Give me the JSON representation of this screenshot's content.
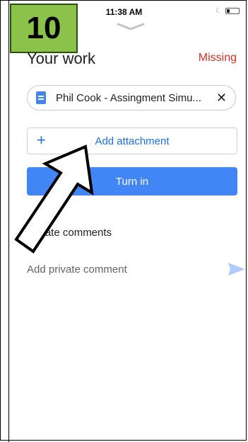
{
  "status_bar": {
    "time": "11:38 AM"
  },
  "step_badge": {
    "number": "10"
  },
  "header": {
    "title": "Your work",
    "status": "Missing"
  },
  "attachment": {
    "file_name": "Phil Cook - Assingment Simu...",
    "remove_symbol": "✕"
  },
  "actions": {
    "add_attachment_label": "Add attachment",
    "turn_in_label": "Turn in",
    "plus_symbol": "+"
  },
  "comments": {
    "heading": "Private comments",
    "placeholder": "Add private comment"
  },
  "colors": {
    "accent": "#4285f4",
    "link": "#1a73e8",
    "missing": "#d93025",
    "badge": "#8bc34a"
  },
  "icons": [
    "moon-icon",
    "battery-icon",
    "drag-handle-icon",
    "doc-icon",
    "close-icon",
    "plus-icon",
    "send-icon",
    "arrow-pointer-icon"
  ]
}
